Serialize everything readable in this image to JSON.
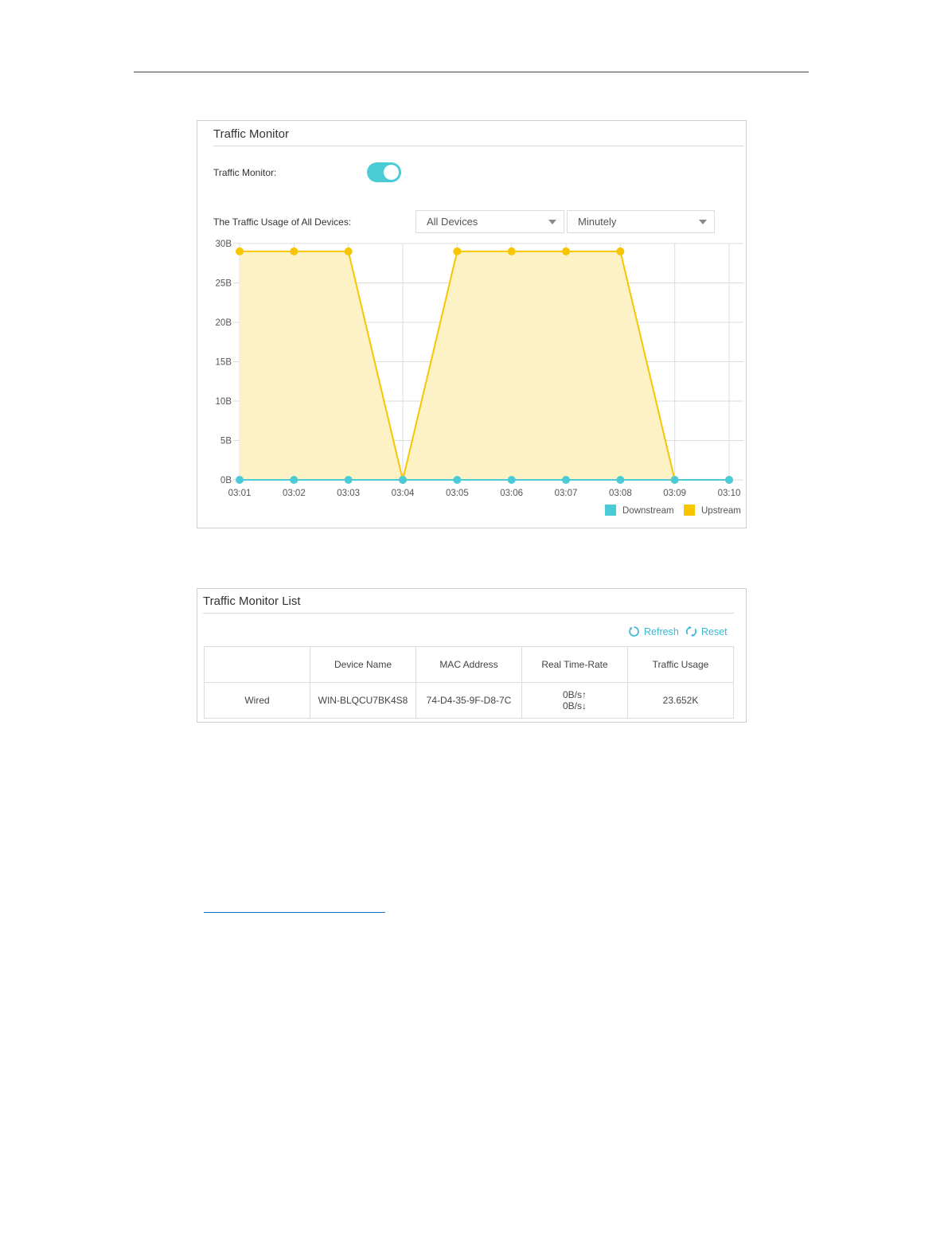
{
  "monitor": {
    "title": "Traffic Monitor",
    "toggle_label": "Traffic Monitor:",
    "toggle_on": true,
    "usage_label": "The Traffic Usage of All Devices:",
    "device_select": "All Devices",
    "interval_select": "Minutely"
  },
  "chart_data": {
    "type": "area",
    "x": [
      "03:01",
      "03:02",
      "03:03",
      "03:04",
      "03:05",
      "03:06",
      "03:07",
      "03:08",
      "03:09",
      "03:10"
    ],
    "y_ticks": [
      "0B",
      "5B",
      "10B",
      "15B",
      "20B",
      "25B",
      "30B"
    ],
    "ylim": [
      0,
      30
    ],
    "grid": true,
    "legend_position": "bottom-right",
    "series": [
      {
        "name": "Downstream",
        "color": "#4acbd6",
        "values": [
          0,
          0,
          0,
          0,
          0,
          0,
          0,
          0,
          0,
          0
        ]
      },
      {
        "name": "Upstream",
        "color": "#f7c600",
        "values": [
          29,
          29,
          29,
          0,
          29,
          29,
          29,
          29,
          0,
          0
        ]
      }
    ]
  },
  "list": {
    "title": "Traffic Monitor List",
    "refresh_label": "Refresh",
    "reset_label": "Reset",
    "accent": "#3bb7d3",
    "columns": [
      "",
      "Device Name",
      "MAC Address",
      "Real Time-Rate",
      "Traffic Usage"
    ],
    "rows": [
      {
        "type": "Wired",
        "device_name": "WIN-BLQCU7BK4S8",
        "mac": "74-D4-35-9F-D8-7C",
        "rate_up": "0B/s↑",
        "rate_down": "0B/s↓",
        "usage": "23.652K"
      }
    ]
  }
}
